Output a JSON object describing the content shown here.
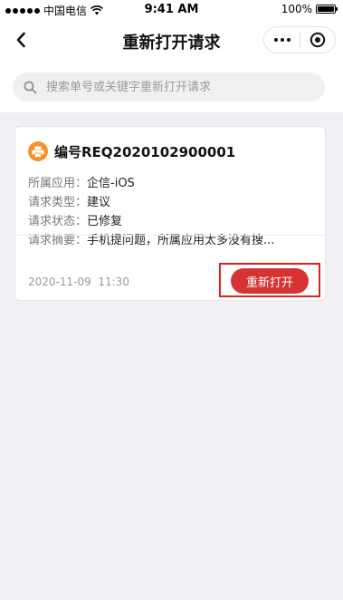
{
  "status_bar": {
    "carrier": "中国电信",
    "time": "9:41 AM",
    "battery": "100%",
    "battery_level": 1.0
  },
  "nav": {
    "title": "重新打开请求"
  },
  "search": {
    "placeholder": "搜索单号或关键字重新打开请求",
    "value": ""
  },
  "request": {
    "number": "编号REQ2020102900001",
    "fields": [
      {
        "label": "所属应用：",
        "value": "企信-iOS"
      },
      {
        "label": "请求类型：",
        "value": "建议"
      },
      {
        "label": "请求状态：",
        "value": "已修复"
      },
      {
        "label": "请求摘要：",
        "value": "手机提问题，所属应用太多没有搜..."
      }
    ],
    "datetime": "2020-11-09  11:30",
    "reopen_label": "重新打开"
  },
  "colors": {
    "accent": "#d63333",
    "highlight": "#e02020",
    "app_icon": "#f5922a",
    "background": "#f0f0f5"
  },
  "icons": {
    "back": "chevron-left-icon",
    "more": "more-dots-icon",
    "close": "target-circle-icon",
    "search": "search-icon",
    "app": "printer-icon"
  }
}
